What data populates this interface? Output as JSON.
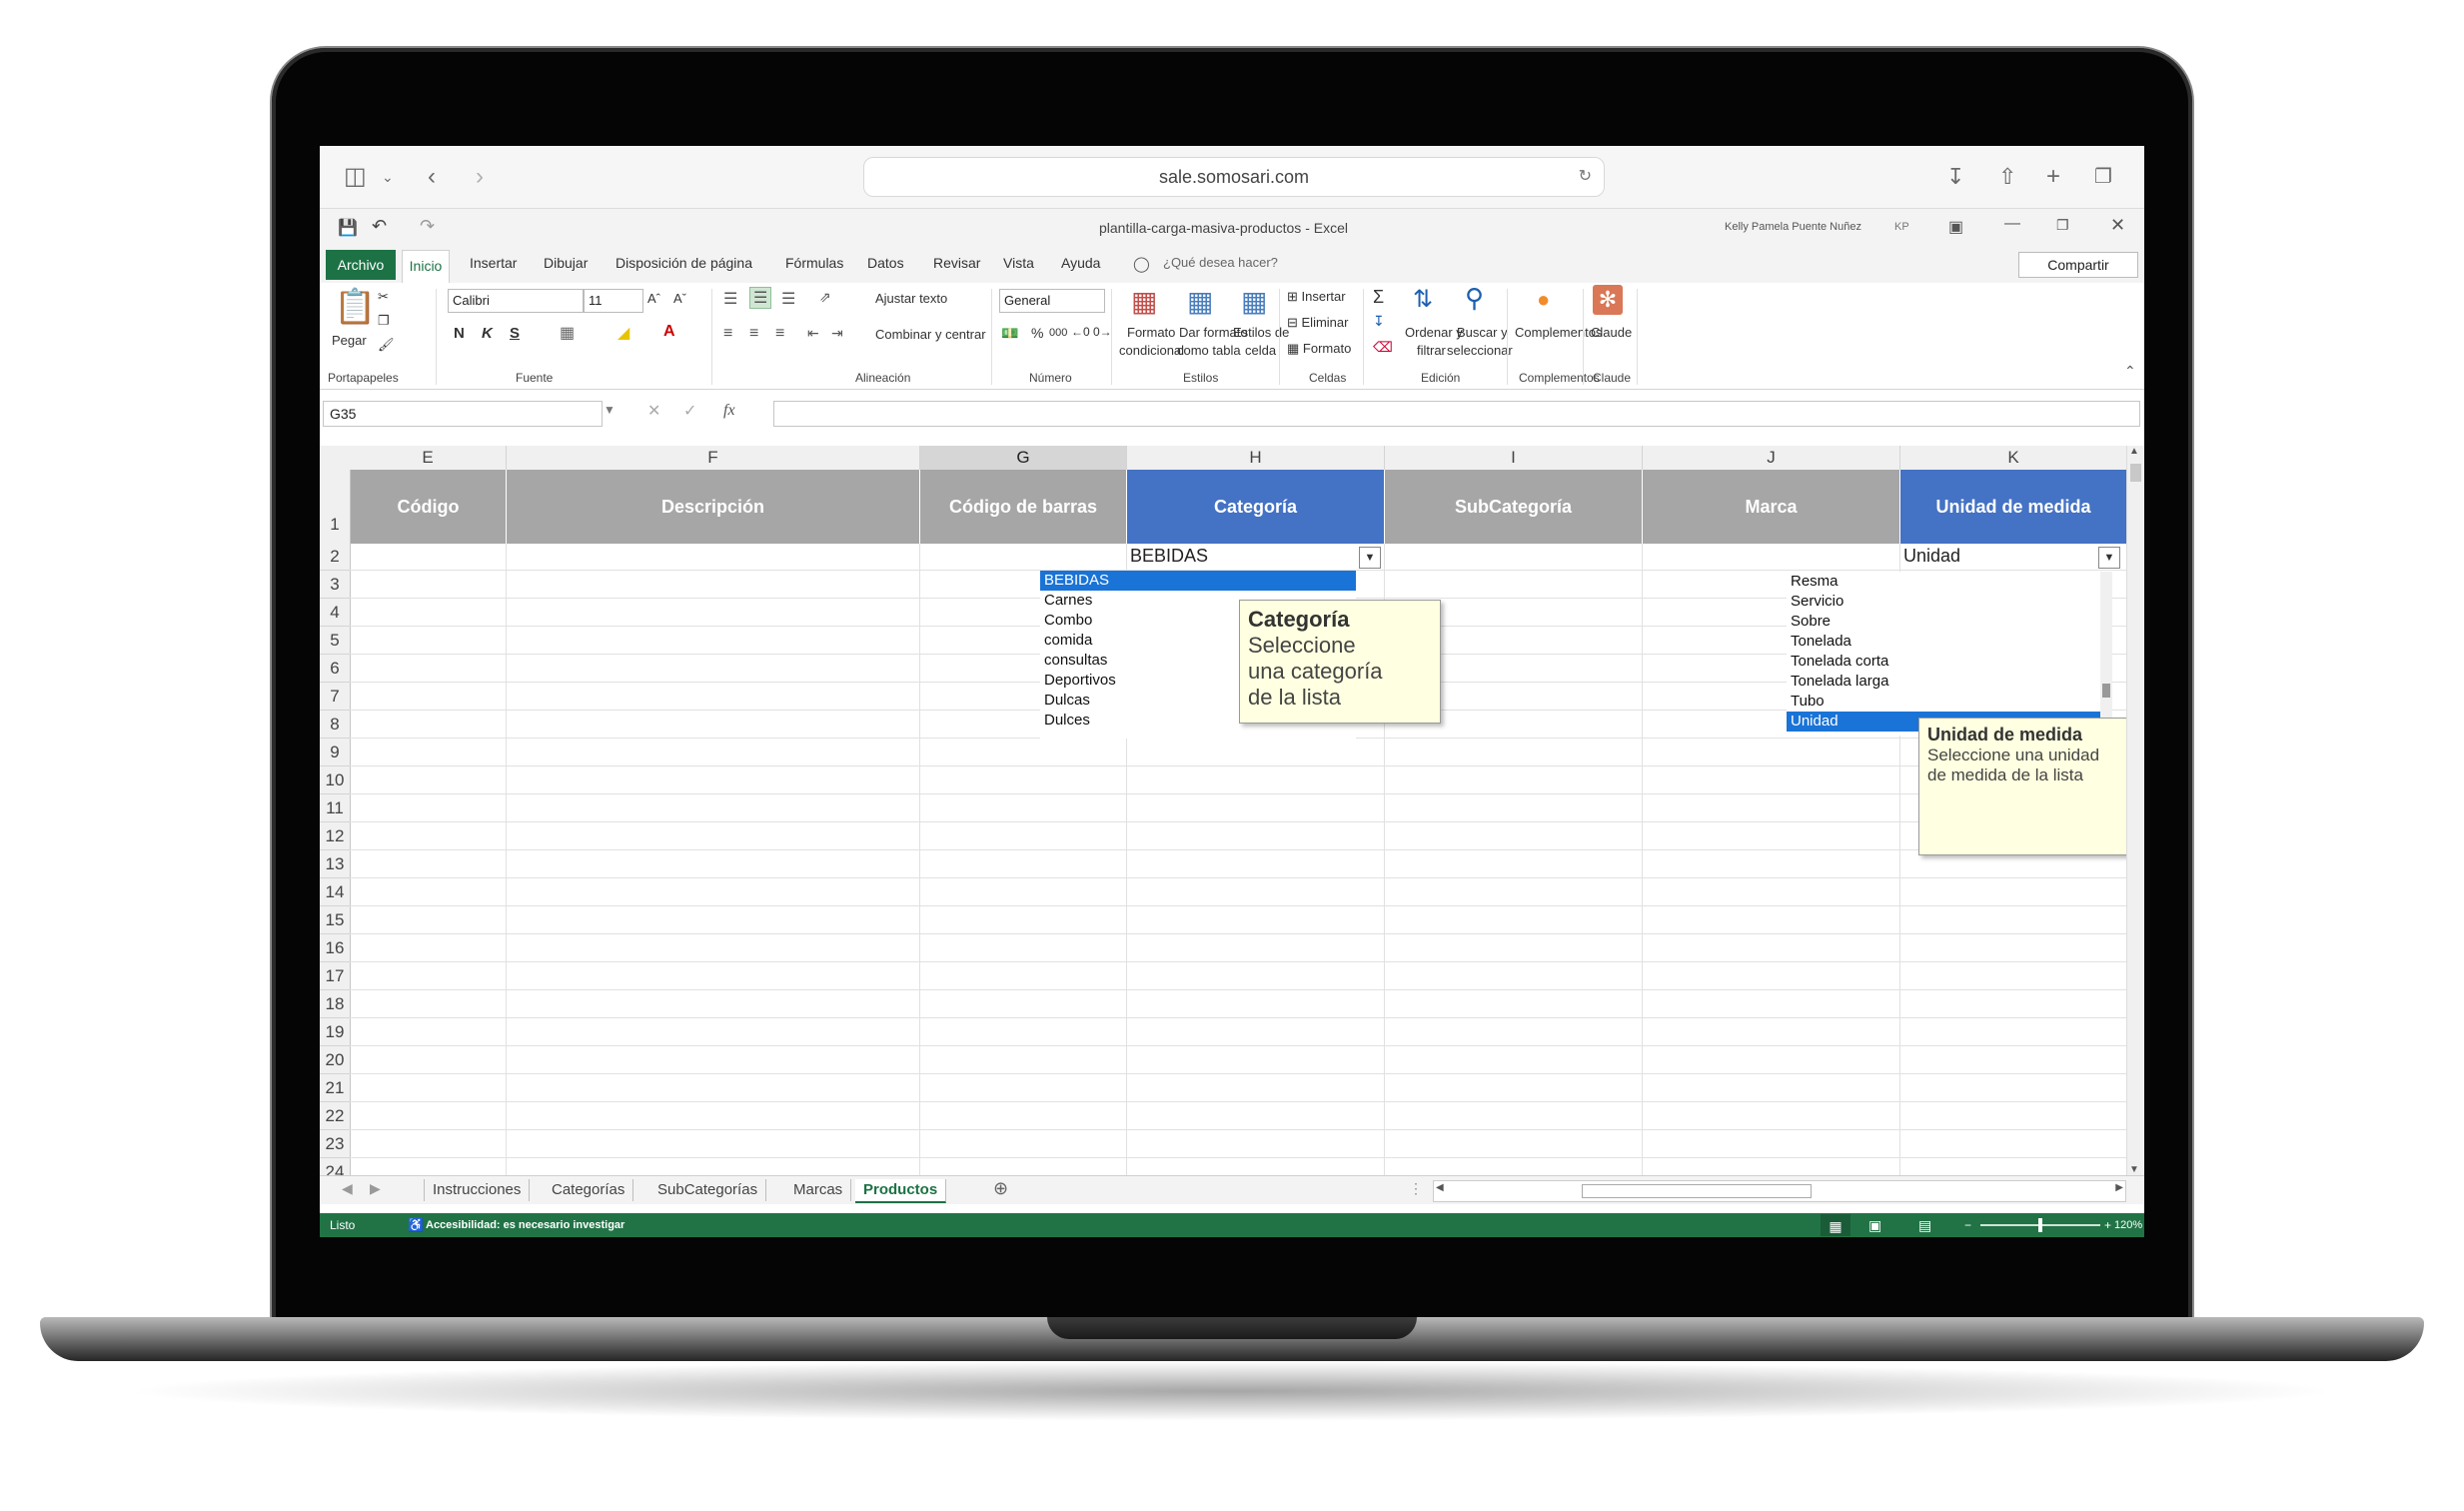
{
  "browser": {
    "url": "sale.somosari.com"
  },
  "excel": {
    "document_title": "plantilla-carga-masiva-productos  -  Excel",
    "user_name": "Kelly Pamela Puente Nuñez",
    "user_initials": "KP",
    "tabs": [
      "Archivo",
      "Inicio",
      "Insertar",
      "Dibujar",
      "Disposición de página",
      "Fórmulas",
      "Datos",
      "Revisar",
      "Vista",
      "Ayuda"
    ],
    "tell_me": "¿Qué desea hacer?",
    "share": "Compartir",
    "ribbon": {
      "paste": "Pegar",
      "clipboard": "Portapapeles",
      "font_name": "Calibri",
      "font_size": "11",
      "font": "Fuente",
      "bold": "N",
      "italic": "K",
      "underline": "S",
      "wrap_text": "Ajustar texto",
      "merge_center": "Combinar y centrar",
      "alignment": "Alineación",
      "number_format": "General",
      "number": "Número",
      "cond_format_1": "Formato",
      "cond_format_2": "condicional",
      "table_format_1": "Dar formato",
      "table_format_2": "como tabla",
      "cell_styles_1": "Estilos de",
      "cell_styles_2": "celda",
      "styles": "Estilos",
      "insert": "Insertar",
      "delete": "Eliminar",
      "format": "Formato",
      "cells": "Celdas",
      "sort_filter_1": "Ordenar y",
      "sort_filter_2": "filtrar",
      "find_select_1": "Buscar y",
      "find_select_2": "seleccionar",
      "editing": "Edición",
      "addins": "Complementos",
      "addins_group": "Complementos",
      "claude": "Claude",
      "claude_group": "Claude"
    },
    "name_box": "G35",
    "fx": "fx",
    "columns": [
      "E",
      "F",
      "G",
      "H",
      "I",
      "J",
      "K"
    ],
    "headers": [
      "Código",
      "Descripción",
      "Código de barras",
      "Categoría",
      "SubCategoría",
      "Marca",
      "Unidad de medida"
    ],
    "rows": [
      "1",
      "2",
      "3",
      "4",
      "5",
      "6",
      "7",
      "8",
      "9",
      "10",
      "11",
      "12",
      "13",
      "14",
      "15",
      "16",
      "17",
      "18",
      "19",
      "20",
      "21",
      "22",
      "23",
      "24"
    ],
    "category_value": "BEBIDAS",
    "category_list": [
      "BEBIDAS",
      "Carnes",
      "Combo",
      "comida",
      "consultas",
      "Deportivos",
      "Dulcas",
      "Dulces"
    ],
    "category_tip": {
      "title": "Categoría",
      "line1": "Seleccione",
      "line2": "una categoría",
      "line3": "de la lista"
    },
    "unit_value": "Unidad",
    "unit_list": [
      "Resma",
      "Servicio",
      "Sobre",
      "Tonelada",
      "Tonelada corta",
      "Tonelada larga",
      "Tubo",
      "Unidad"
    ],
    "unit_tip": {
      "title": "Unidad de medida",
      "line1": "Seleccione una unidad",
      "line2": "de medida de la lista"
    },
    "sheets": [
      "Instrucciones",
      "Categorías",
      "SubCategorías",
      "Marcas",
      "Productos"
    ],
    "status_ready": "Listo",
    "accessibility": "Accesibilidad: es necesario investigar",
    "zoom": "120%",
    "colors": {
      "excel_green": "#217346",
      "header_blue": "#4472c4",
      "header_gray": "#a6a6a6",
      "selection_blue": "#1a73d6"
    }
  }
}
